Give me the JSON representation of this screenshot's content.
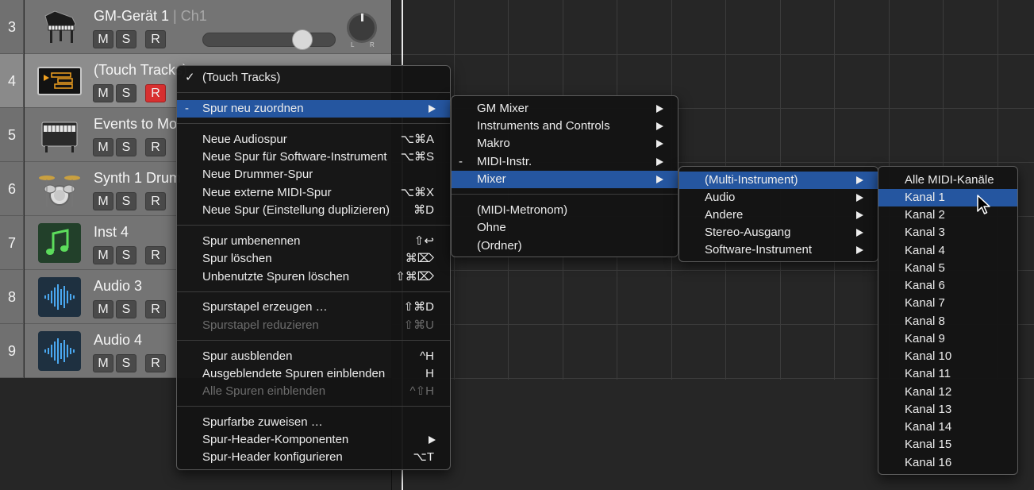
{
  "tracks": [
    {
      "number": "3",
      "name": "GM-Gerät 1",
      "suffix": "| Ch1",
      "icon": "grand-piano-icon",
      "m": "M",
      "s": "S",
      "r": "R",
      "record_armed": false
    },
    {
      "number": "4",
      "name": "(Touch Tracks)",
      "suffix": "",
      "icon": "touch-tracks-icon",
      "m": "M",
      "s": "S",
      "r": "R",
      "record_armed": true
    },
    {
      "number": "5",
      "name": "Events to Mo",
      "suffix": "",
      "icon": "electric-piano-icon",
      "m": "M",
      "s": "S",
      "r": "R",
      "record_armed": false
    },
    {
      "number": "6",
      "name": "Synth 1 Drum",
      "suffix": "",
      "icon": "drum-kit-icon",
      "m": "M",
      "s": "S",
      "r": "R",
      "record_armed": false
    },
    {
      "number": "7",
      "name": "Inst 4",
      "suffix": "",
      "icon": "music-note-icon",
      "m": "M",
      "s": "S",
      "r": "R",
      "record_armed": false
    },
    {
      "number": "8",
      "name": "Audio 3",
      "suffix": "",
      "icon": "audio-waveform-icon",
      "m": "M",
      "s": "S",
      "r": "R",
      "record_armed": false
    },
    {
      "number": "9",
      "name": "Audio 4",
      "suffix": "",
      "icon": "audio-waveform-icon",
      "m": "M",
      "s": "S",
      "r": "R",
      "record_armed": false
    }
  ],
  "pan_labels": {
    "left": "L",
    "right": "R"
  },
  "context_menu": {
    "items": [
      {
        "mark": "✓",
        "label": "(Touch Tracks)",
        "shortcut": ""
      },
      {
        "mark": "-",
        "label": "Spur neu zuordnen",
        "shortcut": "",
        "submenu": true
      },
      {
        "label": "Neue Audiospur",
        "shortcut": "⌥⌘A"
      },
      {
        "label": "Neue Spur für Software-Instrument",
        "shortcut": "⌥⌘S"
      },
      {
        "label": "Neue Drummer-Spur",
        "shortcut": ""
      },
      {
        "label": "Neue externe MIDI-Spur",
        "shortcut": "⌥⌘X"
      },
      {
        "label": "Neue Spur (Einstellung duplizieren)",
        "shortcut": "⌘D"
      },
      {
        "label": "Spur umbenennen",
        "shortcut": "⇧↩"
      },
      {
        "label": "Spur löschen",
        "shortcut": "⌘⌦"
      },
      {
        "label": "Unbenutzte Spuren löschen",
        "shortcut": "⇧⌘⌦"
      },
      {
        "label": "Spurstapel erzeugen …",
        "shortcut": "⇧⌘D"
      },
      {
        "label": "Spurstapel reduzieren",
        "shortcut": "⇧⌘U",
        "disabled": true
      },
      {
        "label": "Spur ausblenden",
        "shortcut": "^H"
      },
      {
        "label": "Ausgeblendete Spuren einblenden",
        "shortcut": "H"
      },
      {
        "label": "Alle Spuren einblenden",
        "shortcut": "^⇧H",
        "disabled": true
      },
      {
        "label": "Spurfarbe zuweisen …",
        "shortcut": ""
      },
      {
        "label": "Spur-Header-Komponenten",
        "shortcut": "",
        "submenu": true
      },
      {
        "label": "Spur-Header konfigurieren",
        "shortcut": "⌥T"
      }
    ]
  },
  "reassign_menu": {
    "items": [
      {
        "label": "GM Mixer",
        "submenu": true
      },
      {
        "label": "Instruments and Controls",
        "submenu": true
      },
      {
        "label": "Makro",
        "submenu": true
      },
      {
        "mark": "-",
        "label": "MIDI-Instr.",
        "submenu": true
      },
      {
        "label": "Mixer",
        "submenu": true
      },
      {
        "label": "(MIDI-Metronom)"
      },
      {
        "label": "Ohne"
      },
      {
        "label": "(Ordner)"
      }
    ]
  },
  "mixer_menu": {
    "items": [
      {
        "label": "(Multi-Instrument)",
        "submenu": true
      },
      {
        "label": "Audio",
        "submenu": true
      },
      {
        "label": "Andere",
        "submenu": true
      },
      {
        "label": "Stereo-Ausgang",
        "submenu": true
      },
      {
        "label": "Software-Instrument",
        "submenu": true
      }
    ]
  },
  "channel_menu": {
    "items": [
      "Alle MIDI-Kanäle",
      "Kanal 1",
      "Kanal 2",
      "Kanal 3",
      "Kanal 4",
      "Kanal 5",
      "Kanal 6",
      "Kanal 7",
      "Kanal 8",
      "Kanal 9",
      "Kanal 10",
      "Kanal 11",
      "Kanal 12",
      "Kanal 13",
      "Kanal 14",
      "Kanal 15",
      "Kanal 16"
    ]
  },
  "colors": {
    "highlight": "#2556a0",
    "record": "#d83030",
    "touch_tracks": "#f0a020",
    "audio_wave": "#4aa8f0",
    "music_note": "#5cdc5c"
  }
}
